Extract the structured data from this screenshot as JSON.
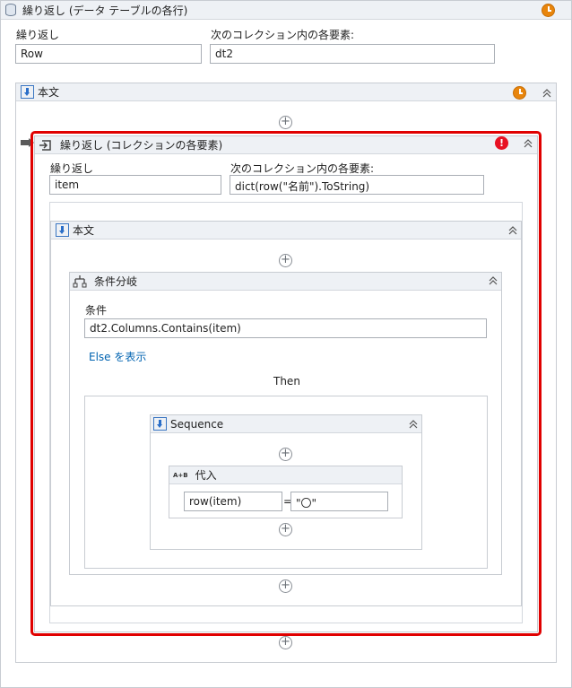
{
  "outer": {
    "title": "繰り返し (データ テーブルの各行)",
    "iterator_label": "繰り返し",
    "iterator_value": "Row",
    "collection_label": "次のコレクション内の各要素:",
    "collection_value": "dt2",
    "body_title": "本文"
  },
  "inner": {
    "title": "繰り返し (コレクションの各要素)",
    "iterator_label": "繰り返し",
    "iterator_value": "item",
    "collection_label": "次のコレクション内の各要素:",
    "collection_value": "dict(row(\"名前\").ToString)",
    "body_title": "本文"
  },
  "if": {
    "title": "条件分岐",
    "condition_label": "条件",
    "condition_value": "dt2.Columns.Contains(item)",
    "else_link": "Else を表示",
    "then_label": "Then"
  },
  "sequence": {
    "title": "Sequence"
  },
  "assign": {
    "title": "代入",
    "icon_text": "A+B",
    "to_value": "row(item)",
    "equals": "=",
    "value": "\"〇\""
  },
  "colors": {
    "error": "#e81123",
    "warning": "#e8850c",
    "highlight": "#e00000",
    "link": "#0063b1"
  }
}
